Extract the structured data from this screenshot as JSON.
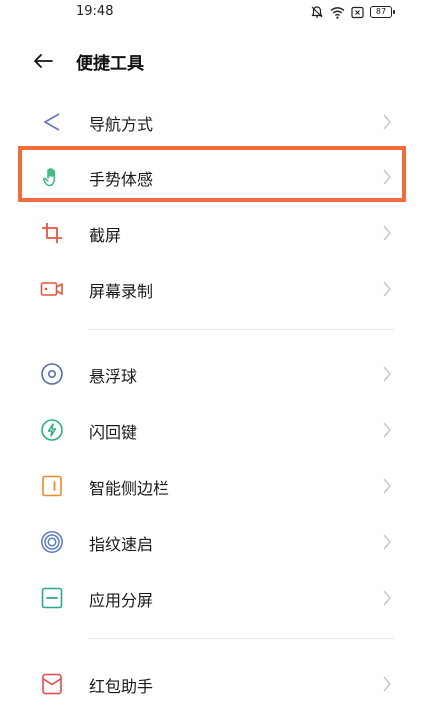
{
  "status_bar": {
    "time": "19:48",
    "battery": "87"
  },
  "header": {
    "title": "便捷工具"
  },
  "items": [
    {
      "label": "导航方式",
      "icon": "navigation-icon"
    },
    {
      "label": "手势体感",
      "icon": "gesture-hand-icon"
    },
    {
      "label": "截屏",
      "icon": "screenshot-crop-icon"
    },
    {
      "label": "屏幕录制",
      "icon": "screen-record-icon"
    },
    {
      "label": "悬浮球",
      "icon": "floating-ball-icon"
    },
    {
      "label": "闪回键",
      "icon": "flashback-key-icon"
    },
    {
      "label": "智能侧边栏",
      "icon": "smart-sidebar-icon"
    },
    {
      "label": "指纹速启",
      "icon": "fingerprint-quick-launch-icon"
    },
    {
      "label": "应用分屏",
      "icon": "split-screen-icon"
    },
    {
      "label": "红包助手",
      "icon": "red-envelope-icon"
    }
  ],
  "colors": {
    "highlight": "#f26b3a",
    "navigation": "#6b7ab8",
    "gesture": "#3bb87a",
    "crop": "#e5553f",
    "record": "#e5553f",
    "floating": "#5a6fa8",
    "flashback": "#2fae7c",
    "sidebar": "#e9892b",
    "fingerprint": "#5b7bc4",
    "split": "#2aa88f",
    "envelope": "#e0484a"
  }
}
